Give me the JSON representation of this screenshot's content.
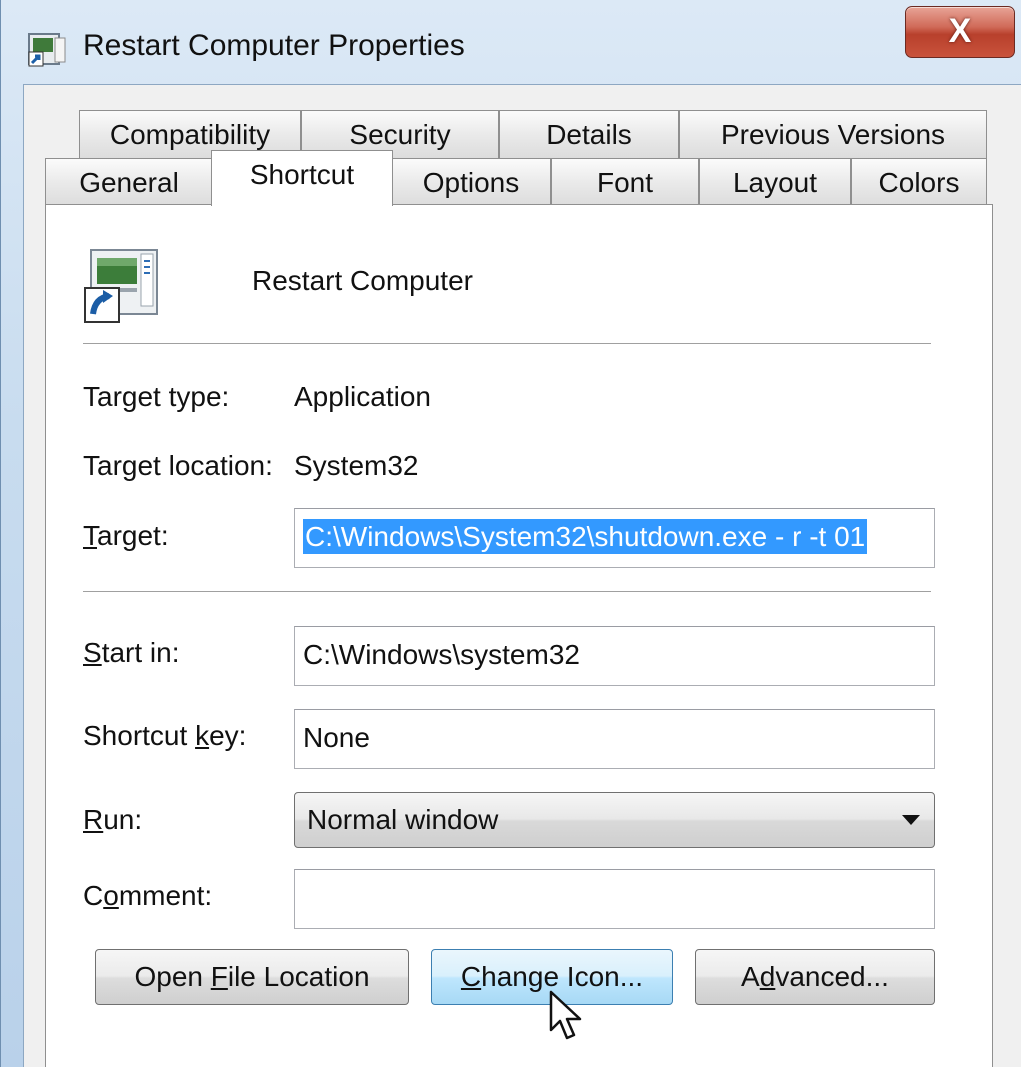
{
  "window": {
    "title": "Restart Computer Properties",
    "close_label": "X"
  },
  "tabs": {
    "row1": [
      {
        "label": "Compatibility"
      },
      {
        "label": "Security"
      },
      {
        "label": "Details"
      },
      {
        "label": "Previous Versions"
      }
    ],
    "row2": [
      {
        "label": "General"
      },
      {
        "label": "Shortcut",
        "active": true
      },
      {
        "label": "Options"
      },
      {
        "label": "Font"
      },
      {
        "label": "Layout"
      },
      {
        "label": "Colors"
      }
    ]
  },
  "shortcut": {
    "name": "Restart Computer",
    "target_type_label": "Target type:",
    "target_type_value": "Application",
    "target_location_label": "Target location:",
    "target_location_value": "System32",
    "target_label_prefix": "",
    "target_label_underlined": "T",
    "target_label_suffix": "arget:",
    "target_value": "C:\\Windows\\System32\\shutdown.exe - r -t 01",
    "start_in_label_underlined": "S",
    "start_in_label_suffix": "tart in:",
    "start_in_value": "C:\\Windows\\system32",
    "shortcut_key_label_prefix": "Shortcut ",
    "shortcut_key_label_underlined": "k",
    "shortcut_key_label_suffix": "ey:",
    "shortcut_key_value": "None",
    "run_label_underlined": "R",
    "run_label_suffix": "un:",
    "run_value": "Normal window",
    "comment_label_prefix": "C",
    "comment_label_underlined": "o",
    "comment_label_suffix": "mment:",
    "comment_value": ""
  },
  "buttons": {
    "open_file_location": {
      "prefix": "Open ",
      "underlined": "F",
      "suffix": "ile Location"
    },
    "change_icon": {
      "prefix": "",
      "underlined": "C",
      "suffix": "hange Icon..."
    },
    "advanced": {
      "prefix": "A",
      "underlined": "d",
      "suffix": "vanced..."
    }
  },
  "colors": {
    "selection": "#3399ff",
    "close_button": "#c9533c",
    "hover_button": "#bee6fd"
  }
}
